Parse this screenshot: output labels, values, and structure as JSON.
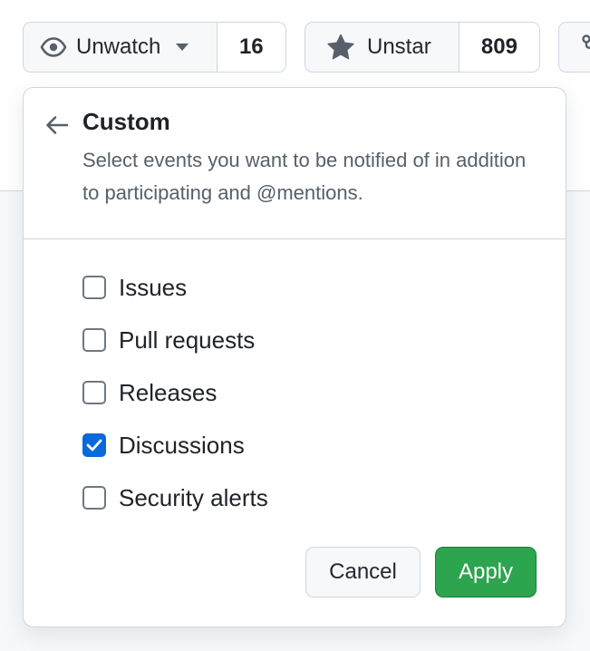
{
  "repo_actions": {
    "watch": {
      "label": "Unwatch",
      "count": "16",
      "icon": "eye-icon",
      "caret_icon": "triangle-down-icon"
    },
    "star": {
      "label": "Unstar",
      "count": "809",
      "icon": "star-fill-icon"
    },
    "fork": {
      "icon": "repo-forked-icon"
    }
  },
  "custom_panel": {
    "back_icon": "arrow-left-icon",
    "title": "Custom",
    "description": "Select events you want to be notified of in addition to participating and @mentions.",
    "options": [
      {
        "label": "Issues",
        "checked": false
      },
      {
        "label": "Pull requests",
        "checked": false
      },
      {
        "label": "Releases",
        "checked": false
      },
      {
        "label": "Discussions",
        "checked": true
      },
      {
        "label": "Security alerts",
        "checked": false
      }
    ],
    "cancel_label": "Cancel",
    "apply_label": "Apply"
  },
  "colors": {
    "accent_blue": "#0969da",
    "apply_green": "#2da44e",
    "border": "#d0d7de",
    "muted_text": "#57606a"
  }
}
